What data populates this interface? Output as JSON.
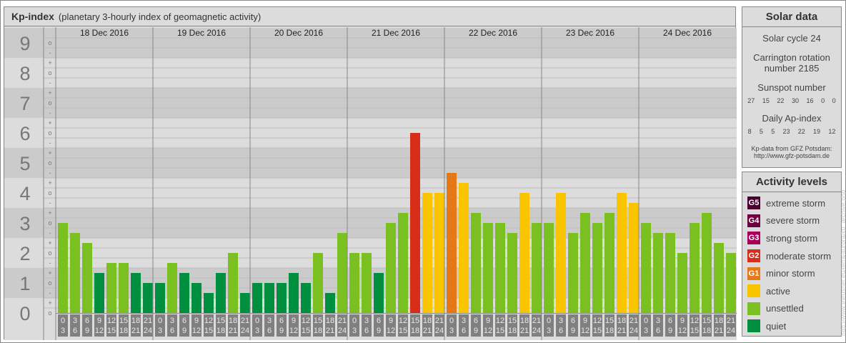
{
  "title": {
    "main": "Kp-index",
    "sub": "(planetary 3-hourly index of geomagnetic activity)"
  },
  "solar": {
    "heading": "Solar data",
    "cycle": "Solar cycle 24",
    "carrington_1": "Carrington rotation",
    "carrington_2": "number 2185",
    "sunspot_label": "Sunspot number",
    "sunspot": [
      "27",
      "15",
      "22",
      "30",
      "16",
      "0",
      "0"
    ],
    "ap_label": "Daily Ap-index",
    "ap": [
      "8",
      "5",
      "5",
      "23",
      "22",
      "19",
      "12"
    ],
    "source_1": "Kp-data from GFZ Potsdam:",
    "source_2": "http://www.gfz-potsdam.de"
  },
  "levels": {
    "heading": "Activity levels",
    "items": [
      {
        "badge": "G5",
        "label": "extreme storm",
        "color": "#4a0030"
      },
      {
        "badge": "G4",
        "label": "severe storm",
        "color": "#6e0040"
      },
      {
        "badge": "G3",
        "label": "strong storm",
        "color": "#a8005a"
      },
      {
        "badge": "G2",
        "label": "moderate storm",
        "color": "#d72e1c"
      },
      {
        "badge": "G1",
        "label": "minor storm",
        "color": "#e57817"
      },
      {
        "badge": "",
        "label": "active",
        "color": "#f8c500"
      },
      {
        "badge": "",
        "label": "unsettled",
        "color": "#7ac021"
      },
      {
        "badge": "",
        "label": "quiet",
        "color": "#008f3e"
      }
    ]
  },
  "watermark": "http://www.theusner.eu/terra/aurora/kp_archive.php",
  "chart_data": {
    "type": "bar",
    "title": "Kp-index",
    "ylim": [
      0,
      9
    ],
    "yticks": [
      "0",
      "1",
      "2",
      "3",
      "4",
      "5",
      "6",
      "7",
      "8",
      "9"
    ],
    "sub_ticks": [
      "o",
      "+",
      "-"
    ],
    "days": [
      "18 Dec 2016",
      "19 Dec 2016",
      "20 Dec 2016",
      "21 Dec 2016",
      "22 Dec 2016",
      "23 Dec 2016",
      "24 Dec 2016"
    ],
    "intervals": [
      [
        "0",
        "3"
      ],
      [
        "3",
        "6"
      ],
      [
        "6",
        "9"
      ],
      [
        "9",
        "12"
      ],
      [
        "12",
        "15"
      ],
      [
        "15",
        "18"
      ],
      [
        "18",
        "21"
      ],
      [
        "21",
        "24"
      ]
    ],
    "kp": [
      [
        "3o",
        "3-",
        "2+",
        "1+",
        "2-",
        "2-",
        "1+",
        "1o"
      ],
      [
        "1o",
        "2-",
        "1+",
        "1o",
        "1-",
        "1+",
        "2o",
        "1-"
      ],
      [
        "1o",
        "1o",
        "1o",
        "1+",
        "1o",
        "2o",
        "1-",
        "3-"
      ],
      [
        "2o",
        "2o",
        "1+",
        "3o",
        "3+",
        "6o",
        "4o",
        "4o"
      ],
      [
        "5-",
        "4+",
        "3+",
        "3o",
        "3o",
        "3-",
        "4o",
        "3o"
      ],
      [
        "3o",
        "4o",
        "3-",
        "3+",
        "3o",
        "3+",
        "4o",
        "4-"
      ],
      [
        "3o",
        "3-",
        "3-",
        "2o",
        "3o",
        "3+",
        "2+",
        "2o"
      ]
    ]
  }
}
